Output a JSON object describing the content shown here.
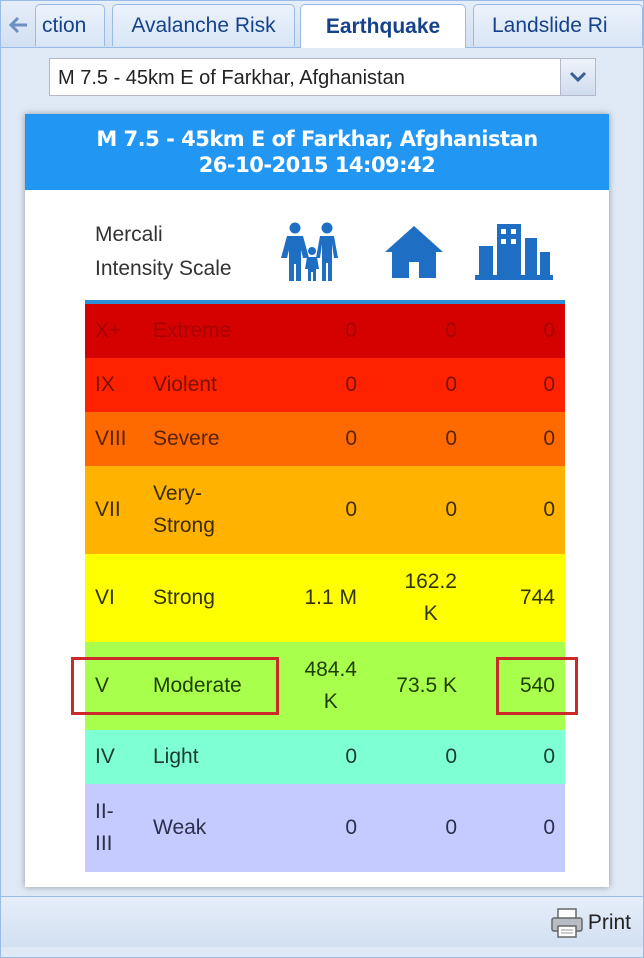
{
  "tabs": [
    {
      "label": "ction",
      "active": false
    },
    {
      "label": "Avalanche Risk",
      "active": false
    },
    {
      "label": "Earthquake",
      "active": true
    },
    {
      "label": "Landslide Ri",
      "active": false
    }
  ],
  "selector": {
    "value": "M 7.5 - 45km E of Farkhar, Afghanistan"
  },
  "card": {
    "title": "M 7.5 - 45km E of Farkhar, Afghanistan",
    "datetime": "26-10-2015 14:09:42",
    "scale_label_line1": "Mercali",
    "scale_label_line2": "Intensity Scale",
    "icons": [
      "people-icon",
      "house-icon",
      "buildings-icon"
    ]
  },
  "rows": [
    {
      "roman": "X+",
      "name": "Extreme",
      "pop": "0",
      "res": "0",
      "bld": "0",
      "color": "#d50000",
      "text": "#a70000"
    },
    {
      "roman": "IX",
      "name": "Violent",
      "pop": "0",
      "res": "0",
      "bld": "0",
      "color": "#ff2200",
      "text": "#7a1000"
    },
    {
      "roman": "VIII",
      "name": "Severe",
      "pop": "0",
      "res": "0",
      "bld": "0",
      "color": "#ff6a00",
      "text": "#5a2300"
    },
    {
      "roman": "VII",
      "name": "Very-\nStrong",
      "pop": "0",
      "res": "0",
      "bld": "0",
      "color": "#ffb300",
      "text": "#3d2d00"
    },
    {
      "roman": "VI",
      "name": "Strong",
      "pop": "1.1 M",
      "res": "162.2\nK",
      "bld": "744",
      "color": "#ffff00",
      "text": "#333300"
    },
    {
      "roman": "V",
      "name": "Moderate",
      "pop": "484.4\nK",
      "res": "73.5 K",
      "bld": "540",
      "color": "#a8ff4c",
      "text": "#1f3d00"
    },
    {
      "roman": "IV",
      "name": "Light",
      "pop": "0",
      "res": "0",
      "bld": "0",
      "color": "#7fffd4",
      "text": "#1d3b33"
    },
    {
      "roman": "II-\nIII",
      "name": "Weak",
      "pop": "0",
      "res": "0",
      "bld": "0",
      "color": "#c5cbff",
      "text": "#2c2f4a"
    }
  ],
  "footer": {
    "print_label": "Print"
  },
  "colors": {
    "accent": "#2196f3",
    "highlight": "#cc2a2a",
    "tab_text": "#15428b"
  }
}
